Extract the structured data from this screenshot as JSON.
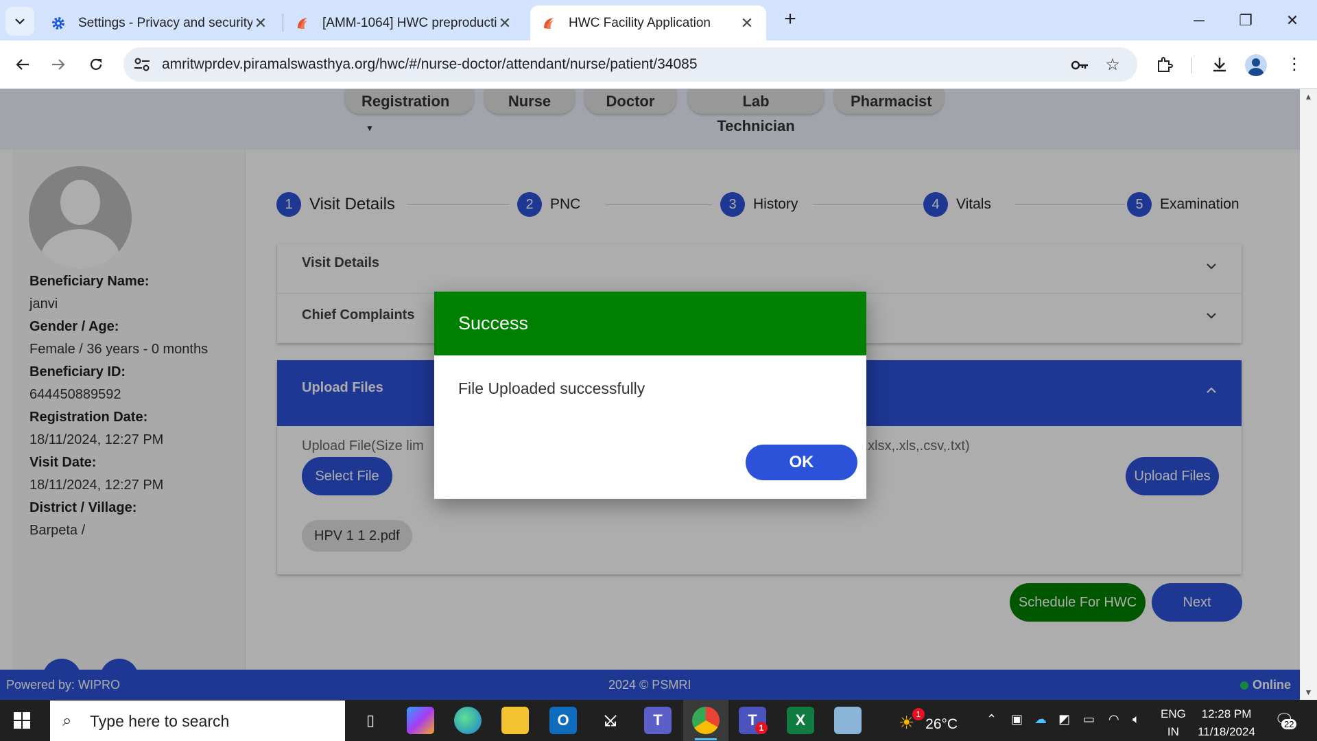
{
  "browser": {
    "tabs": [
      {
        "label": "Settings - Privacy and security",
        "icon": "gear-icon"
      },
      {
        "label": "[AMM-1064] HWC preproductio",
        "icon": "jira-icon"
      },
      {
        "label": "HWC Facility Application",
        "icon": "app-logo-icon"
      }
    ],
    "url": "amritwprdev.piramalswasthya.org/hwc/#/nurse-doctor/attendant/nurse/patient/34085"
  },
  "app": {
    "roles": [
      "Registration",
      "Nurse",
      "Doctor",
      "Lab Technician",
      "Pharmacist"
    ],
    "patient": {
      "name_label": "Beneficiary Name:",
      "name": "janvi",
      "gender_age_label": "Gender / Age:",
      "gender_age": "Female / 36 years - 0 months",
      "id_label": "Beneficiary ID:",
      "id": "644450889592",
      "reg_date_label": "Registration Date:",
      "reg_date": "18/11/2024, 12:27 PM",
      "visit_date_label": "Visit Date:",
      "visit_date": "18/11/2024, 12:27 PM",
      "district_label": "District / Village:",
      "district": "Barpeta /"
    },
    "steps": [
      {
        "num": "1",
        "label": "Visit Details"
      },
      {
        "num": "2",
        "label": "PNC"
      },
      {
        "num": "3",
        "label": "History"
      },
      {
        "num": "4",
        "label": "Vitals"
      },
      {
        "num": "5",
        "label": "Examination"
      }
    ],
    "panels": {
      "visit_details": "Visit Details",
      "chief_complaints": "Chief Complaints",
      "upload_files": "Upload Files"
    },
    "upload": {
      "hint_left": "Upload File(Size lim",
      "hint_right": ",.xlsx,.xls,.csv,.txt)",
      "select_label": "Select File",
      "upload_label": "Upload Files",
      "file_name": "HPV 1 1 2.pdf"
    },
    "actions": {
      "schedule": "Schedule For HWC",
      "next": "Next"
    },
    "footer": {
      "powered": "Powered by: WIPRO",
      "copyright": "2024 © PSMRI",
      "status": "Online"
    }
  },
  "dialog": {
    "title": "Success",
    "message": "File Uploaded successfully",
    "ok_label": "OK"
  },
  "taskbar": {
    "search_placeholder": "Type here to search",
    "temperature": "26°C",
    "weather_badge": "1",
    "teams_badge": "1",
    "lang_top": "ENG",
    "lang_bottom": "IN",
    "time": "12:28 PM",
    "date": "11/18/2024",
    "notifications": "22"
  },
  "colors": {
    "primary": "#2b52d9",
    "success": "#008000",
    "tabstrip": "#d3e3fd"
  }
}
